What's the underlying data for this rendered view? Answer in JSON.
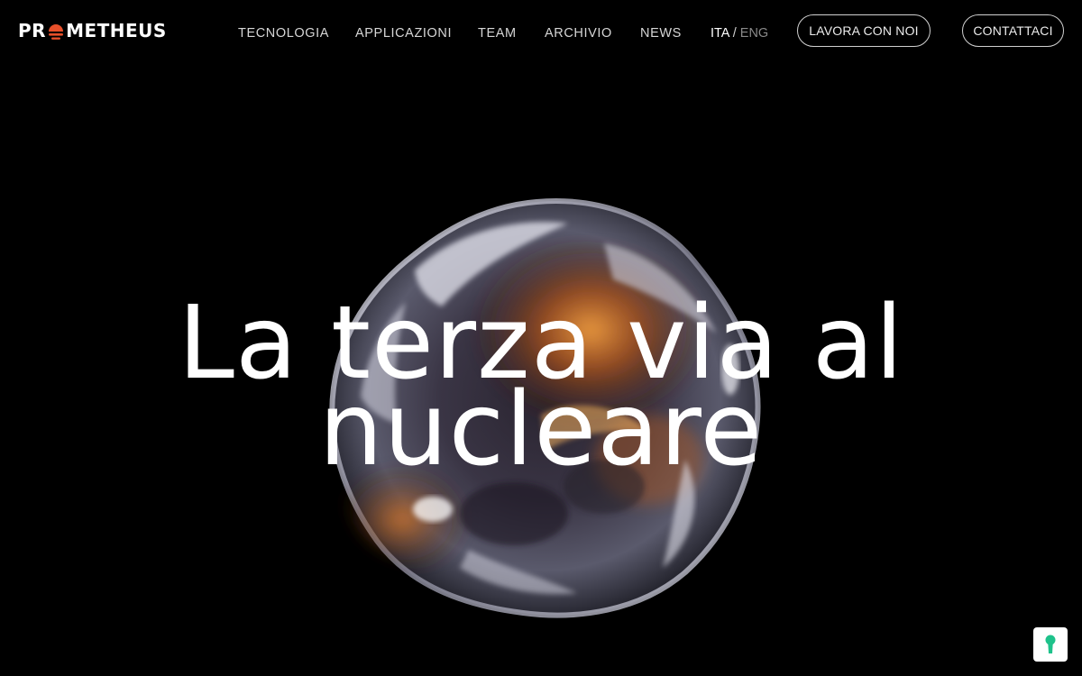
{
  "brand": {
    "logo_text_before": "PR",
    "logo_text_after": "METHEUS",
    "accent_color": "#e8502a"
  },
  "nav": {
    "items": [
      {
        "label": "TECNOLOGIA"
      },
      {
        "label": "APPLICAZIONI"
      },
      {
        "label": "TEAM"
      },
      {
        "label": "ARCHIVIO"
      },
      {
        "label": "NEWS"
      }
    ],
    "language": {
      "active": "ITA",
      "separator": "/",
      "inactive": "ENG"
    },
    "buttons": {
      "careers": "LAVORA CON NOI",
      "contact": "CONTATTACI"
    }
  },
  "hero": {
    "headline_line1": "La terza via al",
    "headline_line2": "nucleare",
    "background_color": "#000000"
  },
  "privacy_button": {
    "icon": "keyhole-icon",
    "icon_color": "#1ec28b"
  }
}
